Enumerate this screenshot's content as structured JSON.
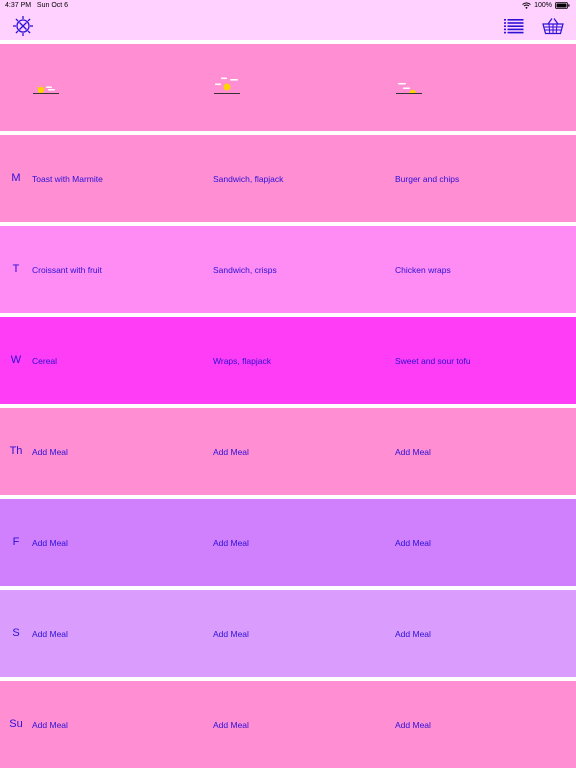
{
  "status_bar": {
    "time": "4:37 PM",
    "date": "Sun Oct 6",
    "battery": "100%"
  },
  "nav": {
    "settings_icon": "gear-sun-icon",
    "list_icon": "list-icon",
    "basket_icon": "basket-icon"
  },
  "header_row": {
    "icons": [
      "breakfast-sunrise-icon",
      "lunch-sun-icon",
      "dinner-sunset-icon"
    ]
  },
  "days": [
    {
      "label": "M",
      "color": "#ff8ed3",
      "breakfast": "Toast with Marmite",
      "lunch": "Sandwich, flapjack",
      "dinner": "Burger and chips"
    },
    {
      "label": "T",
      "color": "#ff8cf5",
      "breakfast": "Croissant with fruit",
      "lunch": "Sandwich, crisps",
      "dinner": "Chicken wraps"
    },
    {
      "label": "W",
      "color": "#ff3cf6",
      "breakfast": "Cereal",
      "lunch": "Wraps, flapjack",
      "dinner": "Sweet and sour tofu"
    },
    {
      "label": "Th",
      "color": "#ff8ed3",
      "breakfast": "Add Meal",
      "lunch": "Add Meal",
      "dinner": "Add Meal"
    },
    {
      "label": "F",
      "color": "#d07ffd",
      "breakfast": "Add Meal",
      "lunch": "Add Meal",
      "dinner": "Add Meal"
    },
    {
      "label": "S",
      "color": "#da9dfe",
      "breakfast": "Add Meal",
      "lunch": "Add Meal",
      "dinner": "Add Meal"
    },
    {
      "label": "Su",
      "color": "#ff8ed3",
      "breakfast": "Add Meal",
      "lunch": "Add Meal",
      "dinner": "Add Meal"
    }
  ],
  "colors": {
    "header_row": "#ff8ed3",
    "text_accent": "#2c10d6",
    "nav_bg": "#ffd1ff"
  }
}
